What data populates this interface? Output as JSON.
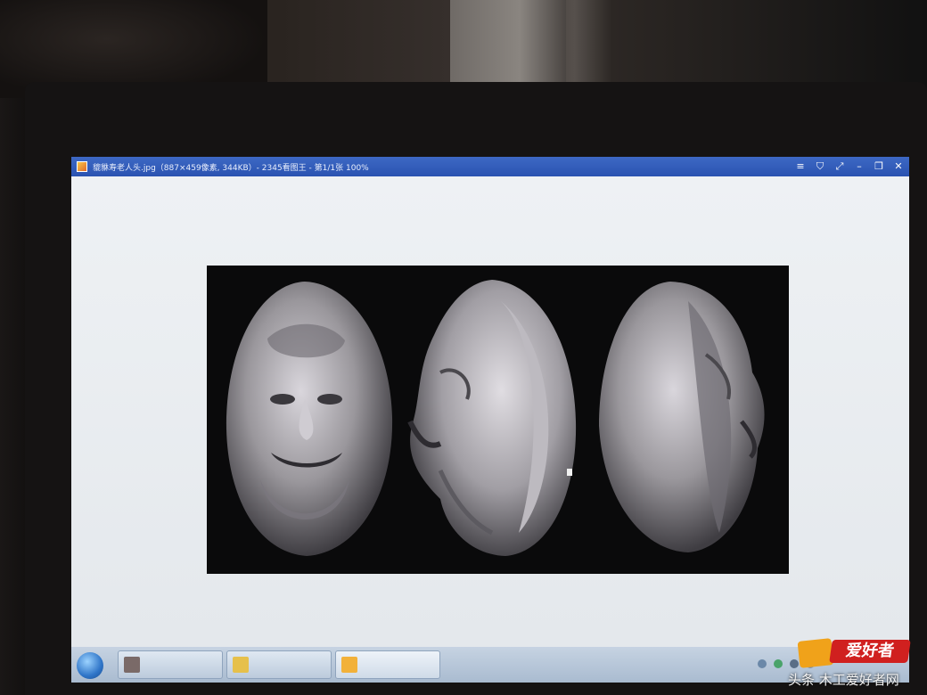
{
  "window": {
    "title": "貔貅寿老人头.jpg（887×459像素, 344KB）- 2345看图王 - 第1/1张 100%",
    "controls": [
      "menu-icon",
      "skin-icon",
      "fullscreen-icon",
      "minimize-icon",
      "restore-icon",
      "close-icon"
    ]
  },
  "image": {
    "alt": "three views of carved old man head",
    "background": "#0a0a0b",
    "sculpt_color": "#9a979c"
  },
  "taskbar": {
    "items": [
      "task-item-1",
      "task-item-2",
      "task-item-3"
    ]
  },
  "watermark": {
    "logo_text": "爱好者",
    "credit": "头条  木工爱好者网"
  },
  "colors": {
    "titlebar": "#2f5bb8",
    "taskbar": "#b8c7d8",
    "logo_red": "#d0201f",
    "logo_orange": "#f0a21a"
  }
}
